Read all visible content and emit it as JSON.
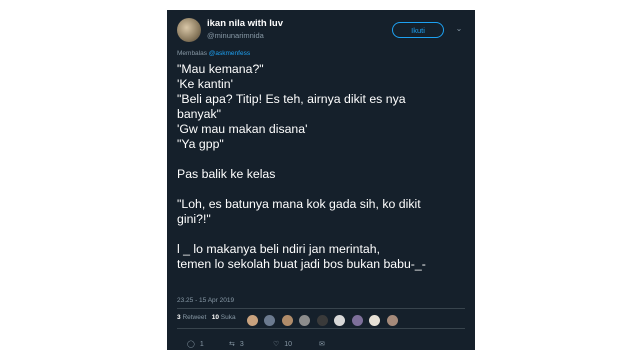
{
  "tweet": {
    "author_name": "ikan nila with luv",
    "author_handle": "@minunarimnida",
    "follow_label": "Ikuti",
    "reply_prefix": "Membalas",
    "reply_to": "@askmenfess",
    "lines": [
      "\"Mau kemana?\"",
      "'Ke kantin'",
      "\"Beli apa? Titip! Es teh, airnya dikit es nya",
      "banyak\"",
      "'Gw mau makan disana'",
      "\"Ya gpp\"",
      "",
      "Pas balik ke kelas",
      "",
      "\"Loh, es batunya mana kok gada sih, ko dikit",
      "gini?!\"",
      "",
      "l _   lo makanya beli ndiri jan merintah,",
      "temen lo sekolah buat jadi bos bukan babu-_-"
    ],
    "timestamp": "23.25 - 15 Apr 2019",
    "retweet_count": "3",
    "retweet_label": "Retweet",
    "like_count": "10",
    "like_label": "Suka",
    "actions": {
      "reply_count": "1",
      "retweet_count": "3",
      "like_count": "10"
    }
  },
  "colors": {
    "card_bg": "#15202b",
    "accent": "#1da1f2",
    "muted": "#8899a6",
    "divider": "#38444d"
  },
  "icons": {
    "reply": "speech-bubble-icon",
    "retweet": "retweet-arrows-icon",
    "like": "heart-icon",
    "dm": "envelope-icon",
    "more": "chevron-down-icon"
  }
}
